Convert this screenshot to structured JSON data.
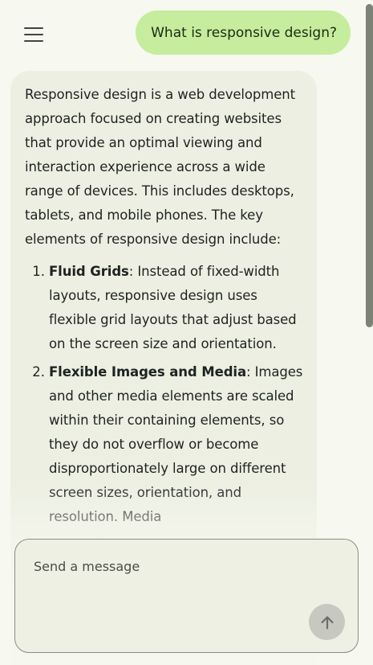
{
  "header": {
    "menu_icon": "hamburger-menu-icon"
  },
  "conversation": {
    "user_message": "What is responsive design?",
    "assistant": {
      "intro": "Responsive design is a web development approach focused on creating websites that provide an optimal viewing and interaction experience across a wide range of devices. This includes desktops, tablets, and mobile phones. The key elements of responsive design include:",
      "items": [
        {
          "title": "Fluid Grids",
          "text": ": Instead of fixed-width layouts, responsive design uses flexible grid layouts that adjust based on the screen size and orientation."
        },
        {
          "title": "Flexible Images and Media",
          "text": ": Images and other media elements are scaled within their containing elements, so they do not overflow or become disproportionately large on different screen sizes, orientation, and resolution. Media"
        }
      ]
    }
  },
  "composer": {
    "placeholder": "Send a message",
    "value": "",
    "send_icon": "arrow-up-icon"
  },
  "colors": {
    "background": "#f7f8ef",
    "user_bubble": "#c5ed9d",
    "assistant_bubble": "#ecefe2",
    "send_button": "#c7c9c0"
  }
}
